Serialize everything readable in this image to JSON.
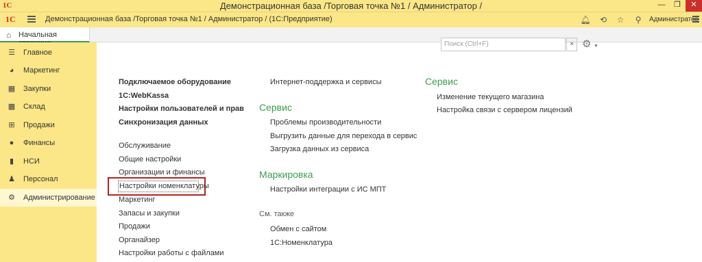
{
  "window": {
    "logo": "1С",
    "title": "Демонстрационная база /Торговая точка №1 / Администратор /",
    "min_glyph": "—",
    "max_glyph": "❐",
    "close_glyph": "✕"
  },
  "appbar": {
    "logo": "1С",
    "path": "Демонстрационная база /Торговая точка №1 / Администратор /  (1С:Предприятие)",
    "user": "Администратор",
    "icons": [
      "bell-icon",
      "history-icon",
      "star-icon",
      "search-icon"
    ]
  },
  "tabs": {
    "home_label": "Начальная страница"
  },
  "sidebar": {
    "items": [
      {
        "label": "Главное",
        "icon": "menu-lines-icon",
        "glyph": "☰"
      },
      {
        "label": "Маркетинг",
        "icon": "pie-chart-icon",
        "glyph": "◕"
      },
      {
        "label": "Закупки",
        "icon": "truck-icon",
        "glyph": "▦"
      },
      {
        "label": "Склад",
        "icon": "warehouse-icon",
        "glyph": "▩"
      },
      {
        "label": "Продажи",
        "icon": "cart-icon",
        "glyph": "⊞"
      },
      {
        "label": "Финансы",
        "icon": "coin-icon",
        "glyph": "●"
      },
      {
        "label": "НСИ",
        "icon": "book-icon",
        "glyph": "▮"
      },
      {
        "label": "Персонал",
        "icon": "person-icon",
        "glyph": "♟"
      },
      {
        "label": "Администрирование",
        "icon": "gear-icon",
        "glyph": "⚙"
      }
    ],
    "active_index": 8
  },
  "search": {
    "placeholder": "Поиск (Ctrl+F)",
    "clear": "×"
  },
  "column1": {
    "bold_links": [
      "Подключаемое оборудование",
      "1C:WebKassa",
      "Настройки пользователей и прав",
      "Синхронизация данных"
    ],
    "links": [
      "Обслуживание",
      "Общие настройки",
      "Организации и финансы",
      "Настройки номенклатуры",
      "Маркетинг",
      "Запасы и закупки",
      "Продажи",
      "Органайзер",
      "Настройки работы с файлами"
    ]
  },
  "column2": {
    "top_link": "Интернет-поддержка и сервисы",
    "service_heading": "Сервис",
    "service_links": [
      "Проблемы производительности",
      "Выгрузить данные для перехода в сервис",
      "Загрузка данных из сервиса"
    ],
    "marking_heading": "Маркировка",
    "marking_links": [
      "Настройки интеграции с ИС МПТ"
    ],
    "seealso_heading": "См. также",
    "seealso_links": [
      "Обмен с сайтом",
      "1С:Номенклатура"
    ]
  },
  "column3": {
    "heading": "Сервис",
    "links": [
      "Изменение текущего магазина",
      "Настройка связи с сервером лицензий"
    ]
  },
  "colors": {
    "accent": "#fbe787",
    "heading_green": "#3c9d4c",
    "highlight_red": "#b22222"
  }
}
